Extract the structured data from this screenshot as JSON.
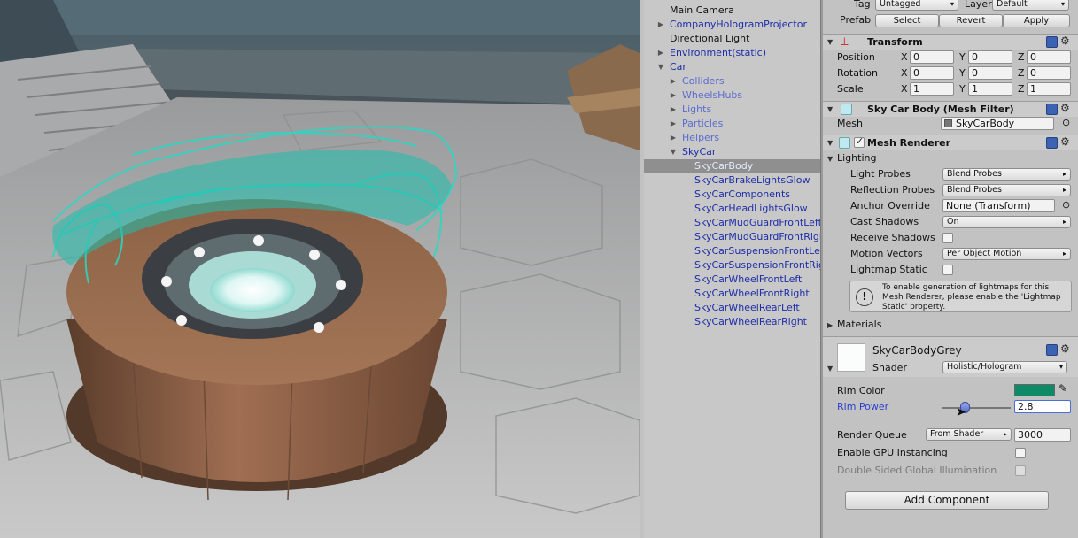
{
  "hierarchy": {
    "rows": [
      {
        "label": "Main Camera",
        "indent": 0,
        "arrow": "",
        "color": "black"
      },
      {
        "label": "CompanyHologramProjector",
        "indent": 0,
        "arrow": "▶",
        "color": "blue"
      },
      {
        "label": "Directional Light",
        "indent": 0,
        "arrow": "",
        "color": "black"
      },
      {
        "label": "Environment(static)",
        "indent": 0,
        "arrow": "▶",
        "color": "blue"
      },
      {
        "label": "Car",
        "indent": 0,
        "arrow": "▼",
        "color": "blue"
      },
      {
        "label": "Colliders",
        "indent": 1,
        "arrow": "▶",
        "color": "lblue"
      },
      {
        "label": "WheelsHubs",
        "indent": 1,
        "arrow": "▶",
        "color": "lblue"
      },
      {
        "label": "Lights",
        "indent": 1,
        "arrow": "▶",
        "color": "lblue"
      },
      {
        "label": "Particles",
        "indent": 1,
        "arrow": "▶",
        "color": "lblue"
      },
      {
        "label": "Helpers",
        "indent": 1,
        "arrow": "▶",
        "color": "lblue"
      },
      {
        "label": "SkyCar",
        "indent": 1,
        "arrow": "▼",
        "color": "blue"
      },
      {
        "label": "SkyCarBody",
        "indent": 2,
        "arrow": "",
        "color": "sel",
        "selected": true
      },
      {
        "label": "SkyCarBrakeLightsGlow",
        "indent": 2,
        "arrow": "",
        "color": "blue"
      },
      {
        "label": "SkyCarComponents",
        "indent": 2,
        "arrow": "",
        "color": "blue"
      },
      {
        "label": "SkyCarHeadLightsGlow",
        "indent": 2,
        "arrow": "",
        "color": "blue"
      },
      {
        "label": "SkyCarMudGuardFrontLeft",
        "indent": 2,
        "arrow": "",
        "color": "blue"
      },
      {
        "label": "SkyCarMudGuardFrontRight",
        "indent": 2,
        "arrow": "",
        "color": "blue"
      },
      {
        "label": "SkyCarSuspensionFrontLeft",
        "indent": 2,
        "arrow": "",
        "color": "blue"
      },
      {
        "label": "SkyCarSuspensionFrontRight",
        "indent": 2,
        "arrow": "",
        "color": "blue"
      },
      {
        "label": "SkyCarWheelFrontLeft",
        "indent": 2,
        "arrow": "",
        "color": "blue"
      },
      {
        "label": "SkyCarWheelFrontRight",
        "indent": 2,
        "arrow": "",
        "color": "blue"
      },
      {
        "label": "SkyCarWheelRearLeft",
        "indent": 2,
        "arrow": "",
        "color": "blue"
      },
      {
        "label": "SkyCarWheelRearRight",
        "indent": 2,
        "arrow": "",
        "color": "blue"
      }
    ]
  },
  "inspector": {
    "header": {
      "tag_label": "Tag",
      "tag_value": "Untagged",
      "layer_label": "Layer",
      "layer_value": "Default",
      "prefab_label": "Prefab",
      "select": "Select",
      "revert": "Revert",
      "apply": "Apply"
    },
    "transform": {
      "title": "Transform",
      "rows": [
        {
          "label": "Position",
          "x": "0",
          "y": "0",
          "z": "0"
        },
        {
          "label": "Rotation",
          "x": "0",
          "y": "0",
          "z": "0"
        },
        {
          "label": "Scale",
          "x": "1",
          "y": "1",
          "z": "1"
        }
      ],
      "x": "X",
      "y": "Y",
      "z": "Z"
    },
    "mesh_filter": {
      "title": "Sky Car Body (Mesh Filter)",
      "mesh_label": "Mesh",
      "mesh_value": "SkyCarBody"
    },
    "mesh_renderer": {
      "title": "Mesh Renderer",
      "enabled": true,
      "lighting_label": "Lighting",
      "light_probes_label": "Light Probes",
      "light_probes_value": "Blend Probes",
      "reflection_probes_label": "Reflection Probes",
      "reflection_probes_value": "Blend Probes",
      "anchor_override_label": "Anchor Override",
      "anchor_override_value": "None (Transform)",
      "cast_shadows_label": "Cast Shadows",
      "cast_shadows_value": "On",
      "receive_shadows_label": "Receive Shadows",
      "receive_shadows": false,
      "motion_vectors_label": "Motion Vectors",
      "motion_vectors_value": "Per Object Motion",
      "lightmap_static_label": "Lightmap Static",
      "lightmap_static": false,
      "info": "To enable generation of lightmaps for this Mesh Renderer, please enable the 'Lightmap Static' property.",
      "materials_label": "Materials"
    },
    "material": {
      "name": "SkyCarBodyGrey",
      "shader_label": "Shader",
      "shader_value": "Holistic/Hologram",
      "rim_color_label": "Rim Color",
      "rim_color": "#0f8a67",
      "rim_power_label": "Rim Power",
      "rim_power_value": "2.8",
      "rim_power_slider_fraction": 0.33,
      "render_queue_label": "Render Queue",
      "render_queue_mode": "From Shader",
      "render_queue_value": "3000",
      "gpu_instancing_label": "Enable GPU Instancing",
      "gpu_instancing": false,
      "double_sided_gi_label": "Double Sided Global Illumination",
      "double_sided_gi": false
    },
    "add_component": "Add Component"
  },
  "colors": {
    "hologram": "#27d9c4",
    "selection": "#8f8f8f",
    "blue_text": "#1e2da8"
  }
}
